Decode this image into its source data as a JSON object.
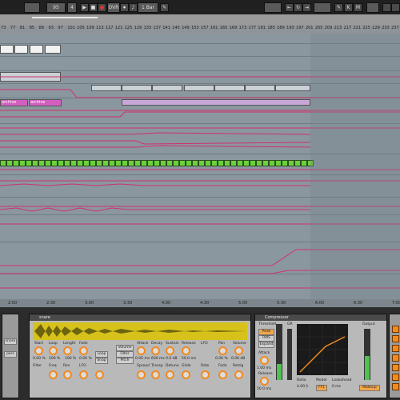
{
  "transport": {
    "tempo": "95",
    "signature": "4",
    "loop_len": "1 Bar",
    "ovr_label": "OVR"
  },
  "ruler": {
    "ticks": [
      "73",
      "77",
      "81",
      "85",
      "89",
      "93",
      "97",
      "101",
      "105",
      "109",
      "113",
      "117",
      "121",
      "125",
      "129",
      "133",
      "137",
      "141",
      "145",
      "149",
      "153",
      "157",
      "161",
      "165",
      "169",
      "173",
      "177",
      "181",
      "185",
      "189",
      "193",
      "197",
      "201",
      "205",
      "209",
      "213",
      "217",
      "221",
      "225",
      "229",
      "233",
      "237"
    ]
  },
  "clips": {
    "muted_label_1": "archive",
    "muted_label_2": "archive"
  },
  "timebar": {
    "labels": [
      "2:00",
      "2:30",
      "3:00",
      "3:30",
      "4:00",
      "4:30",
      "5:00",
      "5:30",
      "6:00",
      "6:30",
      "7:00"
    ]
  },
  "simpler": {
    "name": "snare",
    "left_labels": [
      "Gate",
      "Loop",
      "Length",
      "Fade",
      "Voices",
      "Retrig",
      "Hi Q",
      "Snap"
    ],
    "knob_labels": [
      "Start",
      "Loop",
      "Length",
      "Fade"
    ],
    "knob_values": [
      "0.00 %",
      "100 %",
      "100 %",
      "0.00 %"
    ],
    "loop_btn": "Loop",
    "snap_btn": "Snap",
    "filter_label": "Filter",
    "freq_label": "Freq",
    "res_label": "Res",
    "lfo_label": "LFO",
    "volume_tab": "Volume",
    "filter_tab": "Filter",
    "pitch_tab": "Pitch",
    "env_labels": [
      "Attack",
      "Decay",
      "Sustain",
      "Release"
    ],
    "env_values": [
      "0.00 ms",
      "600 ms",
      "0.0 dB",
      "50.0 ms"
    ],
    "lfo_labels": [
      "Pan",
      "Volume"
    ],
    "lfo_values": [
      "0.00 %",
      "0.00 dB"
    ],
    "spread_label": "Spread",
    "transp_label": "Transp",
    "detune_label": "Detune",
    "glide_label": "Glide",
    "fade_label": "Fade",
    "rate_label": "Rate",
    "retrig_label": "Retrig"
  },
  "compressor": {
    "name": "Compressor",
    "threshold_label": "Threshold",
    "gr_label": "GR",
    "output_label": "Output",
    "peak_btn": "Peak",
    "rms_btn": "RMS",
    "expand_btn": "Expand",
    "attack_label": "Attack",
    "attack_value": "1.00 ms",
    "release_label": "Release",
    "release_value": "50.0 ms",
    "ratio_label": "Ratio",
    "ratio_value": "4.00:1",
    "model_label": "Model",
    "ff_btn": "FF1",
    "lookahead_label": "Lookahead",
    "lookahead_value": "0 ms",
    "makeup_btn": "Makeup"
  },
  "left_strip": {
    "items": [
      "snare",
      "pers"
    ]
  },
  "colors": {
    "accent": "#f28a1e",
    "automation": "#d0306a",
    "clip_green": "#6bd13d",
    "clip_magenta": "#d25fc0"
  }
}
